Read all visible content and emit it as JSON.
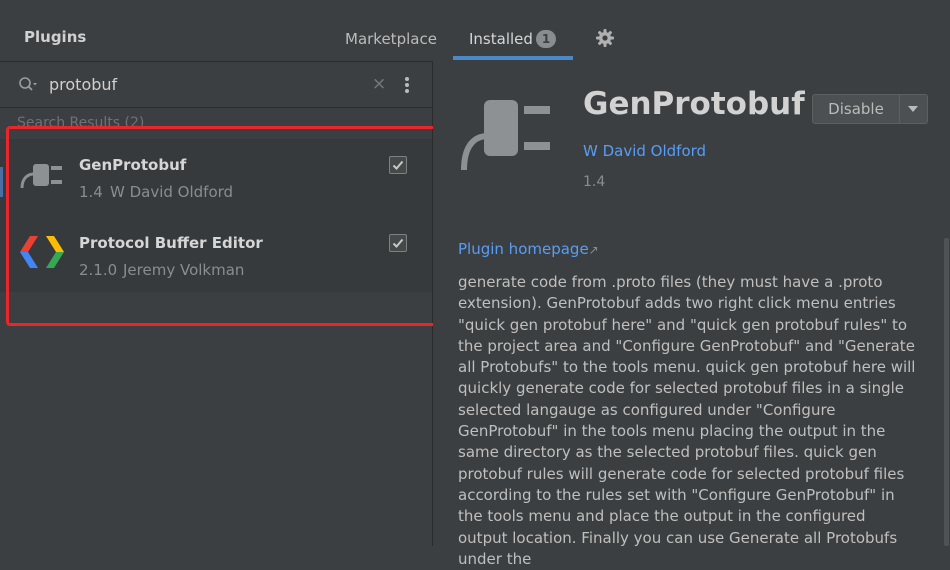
{
  "header": {
    "title": "Plugins",
    "tabs": [
      {
        "label": "Marketplace",
        "active": false
      },
      {
        "label": "Installed",
        "active": true,
        "badge": "1"
      }
    ]
  },
  "search": {
    "query": "protobuf",
    "clear_icon": "×"
  },
  "results": {
    "label": "Search Results (2)",
    "items": [
      {
        "name": "GenProtobuf",
        "version": "1.4",
        "author": "W David Oldford",
        "checked": true,
        "icon": "plug-icon"
      },
      {
        "name": "Protocol Buffer Editor",
        "version": "2.1.0",
        "author": "Jeremy Volkman",
        "checked": true,
        "icon": "google-brackets-icon"
      }
    ]
  },
  "detail": {
    "name": "GenProtobuf",
    "author": "W David Oldford",
    "version": "1.4",
    "disable_label": "Disable",
    "homepage_label": "Plugin homepage",
    "homepage_arrow": "↗",
    "description": "generate code from .proto files (they must have a .proto extension). GenProtobuf adds two right click menu entries \"quick gen protobuf here\" and \"quick gen protobuf rules\" to the project area and \"Configure GenProtobuf\" and \"Generate all Protobufs\" to the tools menu. quick gen protobuf here will quickly generate code for selected protobuf files in a single selected langauge as configured under \"Configure GenProtobuf\" in the tools menu placing the output in the same directory as the selected protobuf files. quick gen protobuf rules will generate code for selected protobuf files according to the rules set with \"Configure GenProtobuf\" in the tools menu and place the output in the configured output location. Finally you can use Generate all Protobufs under the"
  },
  "colors": {
    "accent": "#4a88c7",
    "link": "#589df6",
    "highlight_box": "#e8262b"
  }
}
